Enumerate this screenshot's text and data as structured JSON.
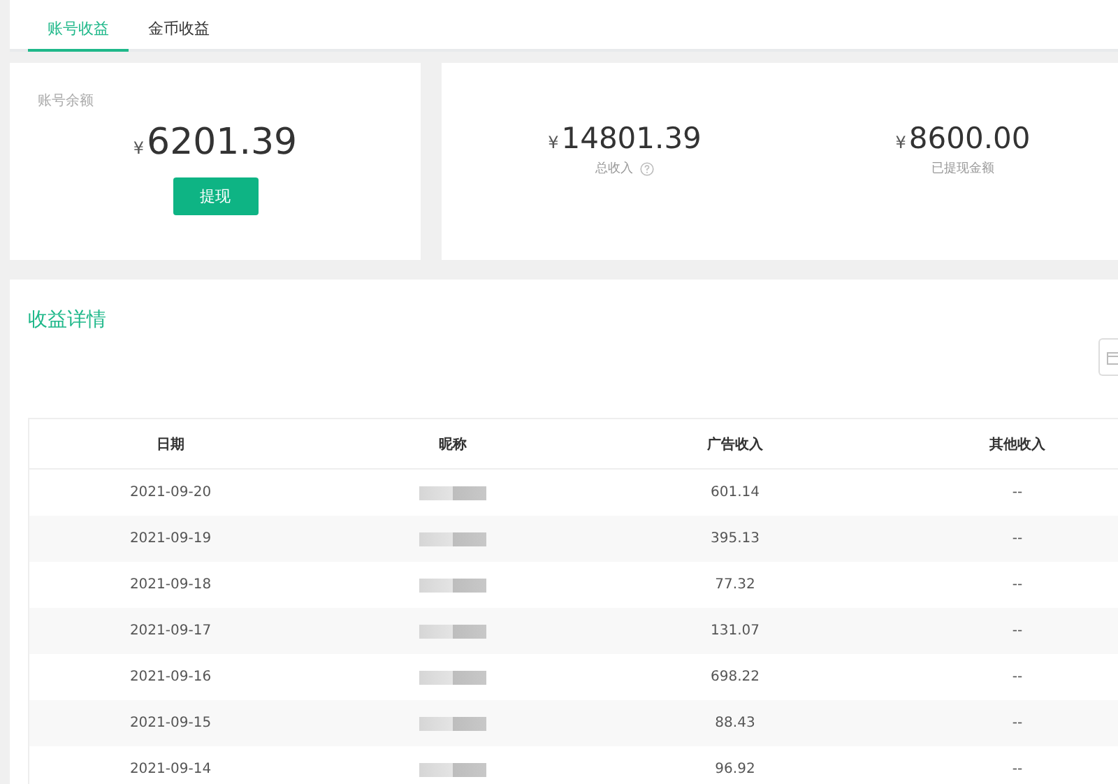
{
  "tabs": [
    {
      "label": "账号收益",
      "selected": true
    },
    {
      "label": "金币收益",
      "selected": false
    }
  ],
  "balance": {
    "label": "账号余额",
    "currency": "¥",
    "amount": "6201.39",
    "button": "提现"
  },
  "totals": [
    {
      "currency": "¥",
      "amount": "14801.39",
      "label": "总收入",
      "help": true
    },
    {
      "currency": "¥",
      "amount": "8600.00",
      "label": "已提现金额",
      "help": false
    }
  ],
  "details": {
    "title": "收益详情",
    "table": {
      "columns": [
        "日期",
        "昵称",
        "广告收入",
        "其他收入"
      ],
      "rows": [
        {
          "date": "2021-09-20",
          "ad_income": "601.14",
          "other_income": "--"
        },
        {
          "date": "2021-09-19",
          "ad_income": "395.13",
          "other_income": "--"
        },
        {
          "date": "2021-09-18",
          "ad_income": "77.32",
          "other_income": "--"
        },
        {
          "date": "2021-09-17",
          "ad_income": "131.07",
          "other_income": "--"
        },
        {
          "date": "2021-09-16",
          "ad_income": "698.22",
          "other_income": "--"
        },
        {
          "date": "2021-09-15",
          "ad_income": "88.43",
          "other_income": "--"
        },
        {
          "date": "2021-09-14",
          "ad_income": "96.92",
          "other_income": "--"
        }
      ]
    }
  }
}
